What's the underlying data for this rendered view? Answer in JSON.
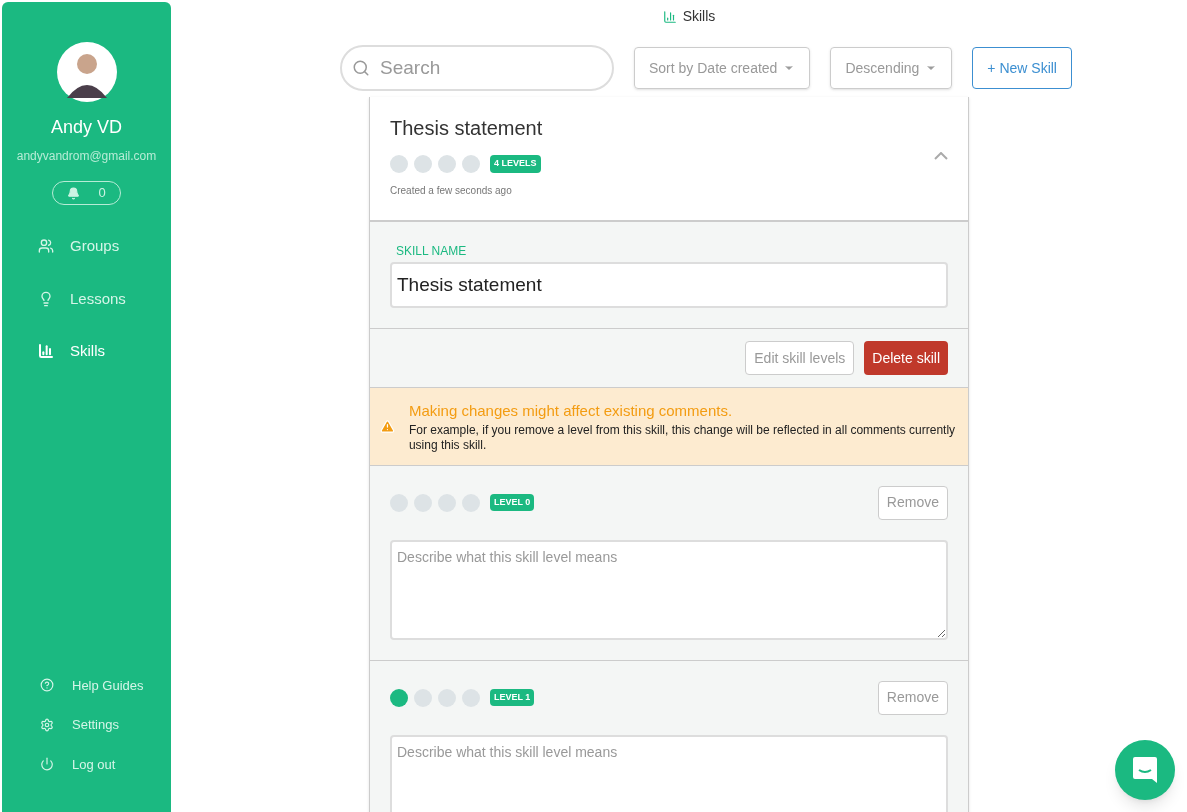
{
  "sidebar": {
    "user_name": "Andy VD",
    "email": "andyvandrom@gmail.com",
    "notifications": "0",
    "items": [
      {
        "label": "Groups",
        "kind": "groups",
        "selected": false
      },
      {
        "label": "Lessons",
        "kind": "bulb",
        "selected": false
      },
      {
        "label": "Skills",
        "kind": "chart",
        "selected": true
      }
    ],
    "footer_items": [
      {
        "label": "Help Guides",
        "kind": "help"
      },
      {
        "label": "Settings",
        "kind": "gear"
      },
      {
        "label": "Log out",
        "kind": "power"
      }
    ]
  },
  "page_title": "Skills",
  "toolbar": {
    "search_placeholder": "Search",
    "sort": "Sort by Date created",
    "order": "Descending",
    "new_button": "+ New Skill"
  },
  "skill": {
    "name": "Thesis statement",
    "stars": 0,
    "badge": "4 LEVELS",
    "created": "Created a few seconds ago",
    "expanded": true,
    "field_label": "SKILL NAME",
    "field_value": "Thesis statement",
    "buttons": {
      "edit": "Edit skill levels",
      "delete": "Delete skill"
    },
    "warning": {
      "title": "Making changes might affect existing comments.",
      "body": "For example, if you remove a level from this skill, this change will be reflected in all comments currently using this skill."
    },
    "levels": [
      {
        "badge": "LEVEL 0",
        "stars": 0,
        "remove": "Remove",
        "placeholder": "Describe what this skill level means"
      },
      {
        "badge": "LEVEL 1",
        "stars": 1,
        "remove": "Remove",
        "placeholder": "Describe what this skill level means"
      }
    ]
  }
}
